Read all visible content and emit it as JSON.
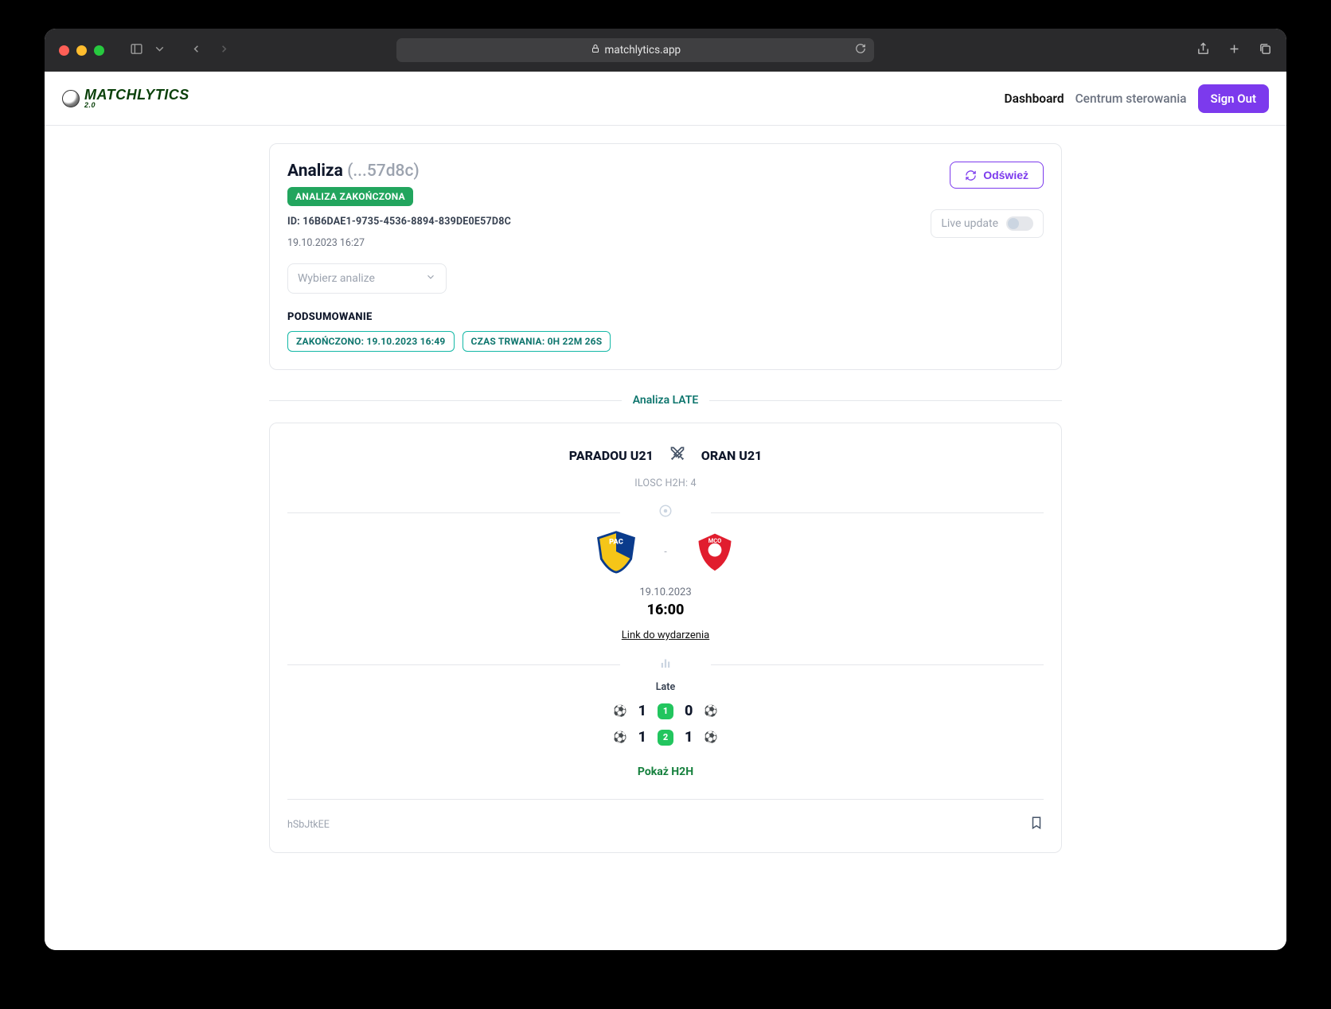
{
  "browser": {
    "url_host": "matchlytics.app"
  },
  "app": {
    "logo_text": "MATCHLYTICS",
    "logo_sub": "2.0",
    "nav": {
      "dashboard": "Dashboard",
      "centrum": "Centrum sterowania",
      "signout": "Sign Out"
    }
  },
  "analysis": {
    "title": "Analiza",
    "title_suffix": "(...57d8c)",
    "status_badge": "ANALIZA ZAKOŃCZONA",
    "id_prefix": "ID:",
    "id": "16B6DAE1-9735-4536-8894-839DE0E57D8C",
    "created": "19.10.2023 16:27",
    "refresh": "Odśwież",
    "live_update": "Live update",
    "select_placeholder": "Wybierz analize",
    "summary_heading": "PODSUMOWANIE",
    "chip_finished": "ZAKOŃCZONO: 19.10.2023 16:49",
    "chip_duration": "CZAS TRWANIA: 0H 22M 26S"
  },
  "section": {
    "label": "Analiza LATE"
  },
  "match": {
    "home": "PARADOU U21",
    "away": "ORAN U21",
    "h2h_count": "ILOSC H2H: 4",
    "score_separator": "-",
    "date": "19.10.2023",
    "time": "16:00",
    "event_link": "Link do wydarzenia",
    "late_label": "Late",
    "half1": {
      "badge": "1",
      "home": "1",
      "away": "0"
    },
    "half2": {
      "badge": "2",
      "home": "1",
      "away": "1"
    },
    "show_h2h": "Pokaż H2H",
    "footer_id": "hSbJtkEE"
  }
}
